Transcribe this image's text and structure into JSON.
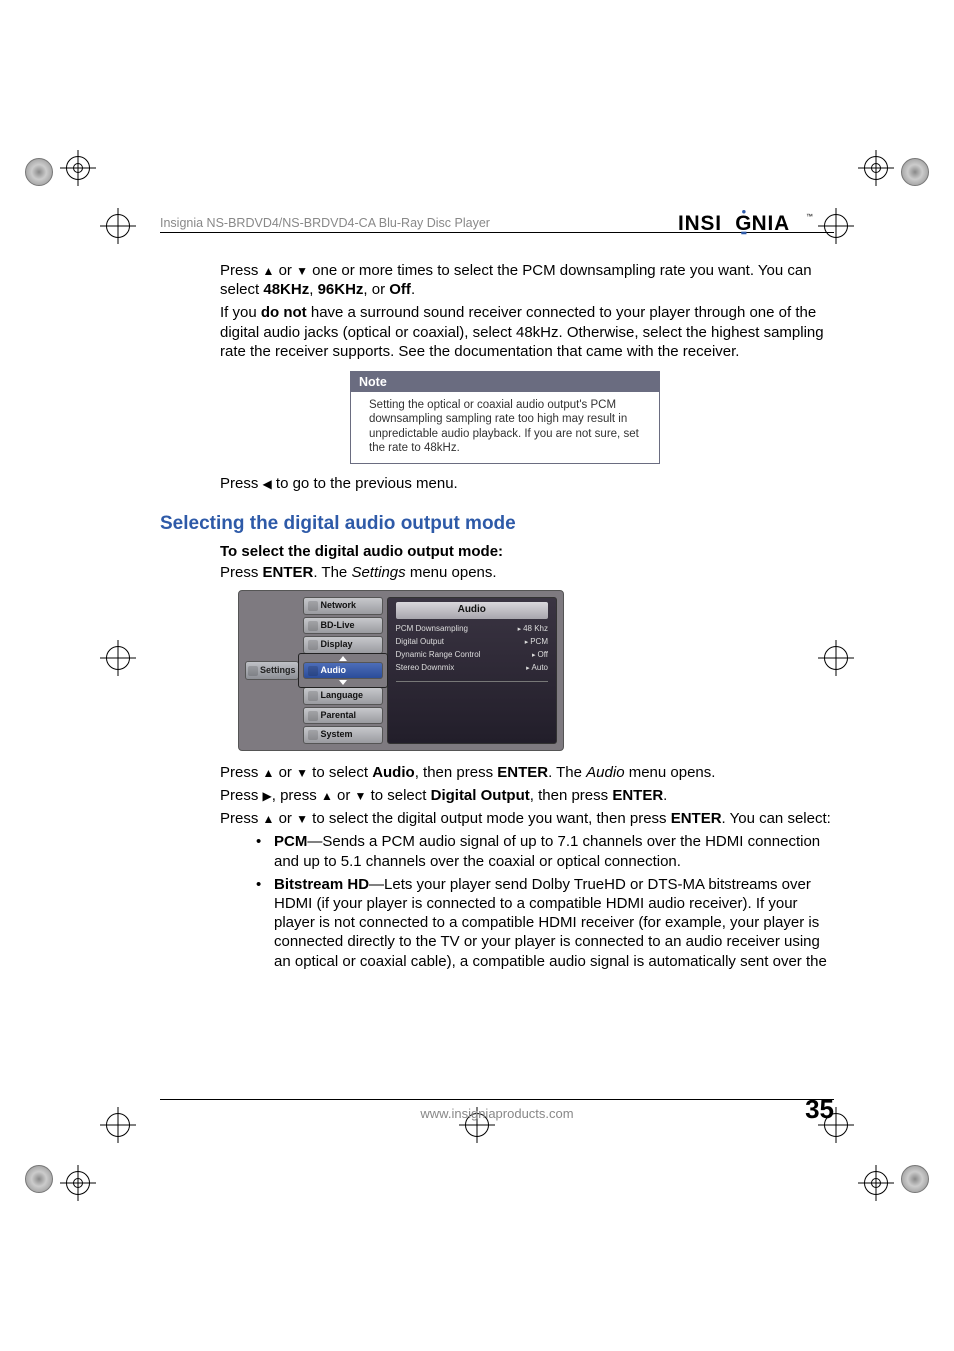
{
  "header": {
    "product_line": "Insignia NS-BRDVD4/NS-BRDVD4-CA Blu-Ray Disc Player",
    "brand": "INSIGNIA"
  },
  "intro": {
    "line1_pre": "Press ",
    "line1_mid": " or ",
    "line1_post": " one or more times to select the PCM downsampling rate you want. You can select ",
    "opt1": "48KHz",
    "opt_sep": ", ",
    "opt2": "96KHz",
    "opt_or": ", or ",
    "opt3": "Off",
    "opt_end": ".",
    "line2_pre": "If you ",
    "line2_bold": "do not",
    "line2_post": " have a surround sound receiver connected to your player through one of the digital audio jacks (optical or coaxial), select 48kHz. Otherwise, select the highest sampling rate the receiver supports. See the documentation that came with the receiver."
  },
  "note": {
    "label": "Note",
    "text": "Setting the optical or coaxial audio output's PCM downsampling sampling rate too high may result in unpredictable audio playback. If you are not sure, set the rate to 48kHz."
  },
  "prev_menu": {
    "pre": "Press ",
    "post": " to go to the previous menu."
  },
  "section": {
    "title": "Selecting the digital audio output mode",
    "subtitle": "To select the digital audio output mode:",
    "step1_pre": "Press ",
    "step1_bold": "ENTER",
    "step1_mid": ". The ",
    "step1_italic": "Settings",
    "step1_post": " menu opens."
  },
  "osd": {
    "settings_label": "Settings",
    "panel_title": "Audio",
    "menu": [
      {
        "label": "Network"
      },
      {
        "label": "BD-Live"
      },
      {
        "label": "Display"
      },
      {
        "label": "Audio",
        "active": true
      },
      {
        "label": "Language"
      },
      {
        "label": "Parental"
      },
      {
        "label": "System"
      }
    ],
    "rows": [
      {
        "k": "PCM Downsampling",
        "v": "48 Khz"
      },
      {
        "k": "Digital Output",
        "v": "PCM"
      },
      {
        "k": "Dynamic Range Control",
        "v": "Off"
      },
      {
        "k": "Stereo Downmix",
        "v": "Auto"
      }
    ]
  },
  "steps": {
    "s2_pre": "Press ",
    "s2_mid1": " or ",
    "s2_mid2": " to select ",
    "s2_b1": "Audio",
    "s2_mid3": ", then press ",
    "s2_b2": "ENTER",
    "s2_mid4": ". The ",
    "s2_i": "Audio",
    "s2_post": " menu opens.",
    "s3_pre": "Press ",
    "s3_mid1": ", press ",
    "s3_mid2": " or ",
    "s3_mid3": " to select ",
    "s3_b1": "Digital Output",
    "s3_mid4": ", then press ",
    "s3_b2": "ENTER",
    "s3_end": ".",
    "s4_pre": "Press ",
    "s4_mid1": " or ",
    "s4_mid2": " to select the digital output mode you want, then press ",
    "s4_b": "ENTER",
    "s4_post": ". You can select:"
  },
  "bullets": {
    "b1_b": "PCM",
    "b1_t": "—Sends a PCM audio signal of up to 7.1 channels over the HDMI connection and up to 5.1 channels over the coaxial or optical connection.",
    "b2_b": "Bitstream HD",
    "b2_t": "—Lets your player send Dolby TrueHD or DTS-MA bitstreams over HDMI (if your player is connected to a compatible HDMI audio receiver). If your player is not connected to a compatible HDMI receiver (for example, your player is connected directly to the TV or your player is connected to an audio receiver using an optical or coaxial cable), a compatible audio signal is automatically sent over the"
  },
  "footer": {
    "url": "www.insigniaproducts.com",
    "page": "35"
  },
  "glyphs": {
    "up": "▲",
    "down": "▼",
    "left": "◀",
    "right": "▶"
  }
}
